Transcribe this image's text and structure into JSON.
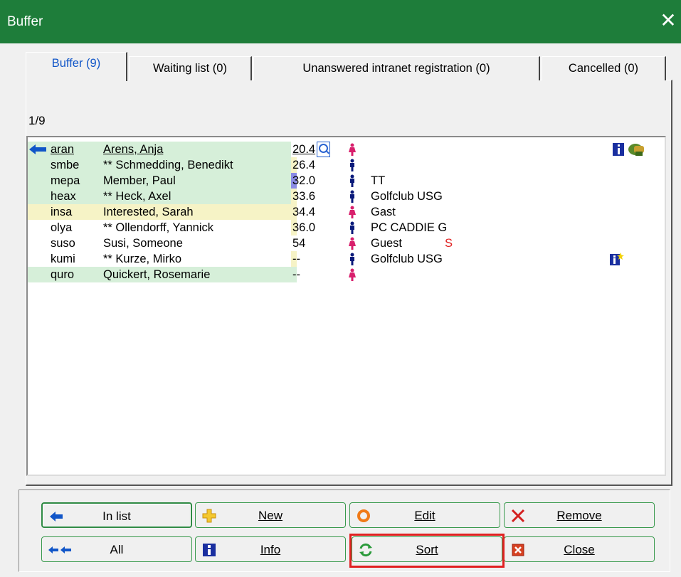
{
  "window": {
    "title": "Buffer",
    "close_glyph": "✕"
  },
  "tabs": [
    {
      "label": "Buffer (9)",
      "active": true
    },
    {
      "label": "Waiting list (0)",
      "active": false
    },
    {
      "label": "Unanswered intranet registration (0)",
      "active": false
    },
    {
      "label": "Cancelled (0)",
      "active": false
    }
  ],
  "counter": "1/9",
  "rows": [
    {
      "code": "aran",
      "name": "Arens, Anja",
      "hcp": "20.4",
      "gender": "female",
      "club": "",
      "flag": "",
      "icons": [
        "info-icon",
        "golf-bag-icon"
      ],
      "selected": true
    },
    {
      "code": "smbe",
      "name": "** Schmedding, Benedikt",
      "hcp": "26.4",
      "gender": "male",
      "club": "",
      "flag": "",
      "icons": []
    },
    {
      "code": "mepa",
      "name": "Member, Paul",
      "hcp": "32.0",
      "gender": "male",
      "club": "TT",
      "flag": "",
      "icons": []
    },
    {
      "code": "heax",
      "name": "** Heck, Axel",
      "hcp": "33.6",
      "gender": "male",
      "club": "Golfclub USG",
      "flag": "",
      "icons": []
    },
    {
      "code": "insa",
      "name": "Interested, Sarah",
      "hcp": "34.4",
      "gender": "female",
      "club": "Gast",
      "flag": "",
      "icons": []
    },
    {
      "code": "olya",
      "name": "** Ollendorff, Yannick",
      "hcp": "36.0",
      "gender": "male",
      "club": "PC CADDIE G",
      "flag": "",
      "icons": []
    },
    {
      "code": "suso",
      "name": "Susi, Someone",
      "hcp": "54",
      "gender": "female",
      "club": "Guest",
      "flag": "S",
      "icons": []
    },
    {
      "code": "kumi",
      "name": "** Kurze, Mirko",
      "hcp": "--",
      "gender": "male",
      "club": "Golfclub USG",
      "flag": "",
      "icons": [
        "info-new-icon"
      ]
    },
    {
      "code": "quro",
      "name": "Quickert, Rosemarie",
      "hcp": "--",
      "gender": "female",
      "club": "",
      "flag": "",
      "icons": []
    }
  ],
  "buttons": {
    "in_list": "In list",
    "new": "New",
    "edit": "Edit",
    "remove": "Remove",
    "all": "All",
    "info": "Info",
    "sort": "Sort",
    "close": "Close"
  },
  "colors": {
    "titlebar": "#1e7d3a",
    "row_green": "#d6efd9",
    "row_yellow": "#f6f3c6",
    "hcp_blue": "#8c8ce6",
    "male": "#0a1a7a",
    "female": "#d81f6c",
    "accent_blue": "#1156c8",
    "highlight_red": "#e02020"
  }
}
